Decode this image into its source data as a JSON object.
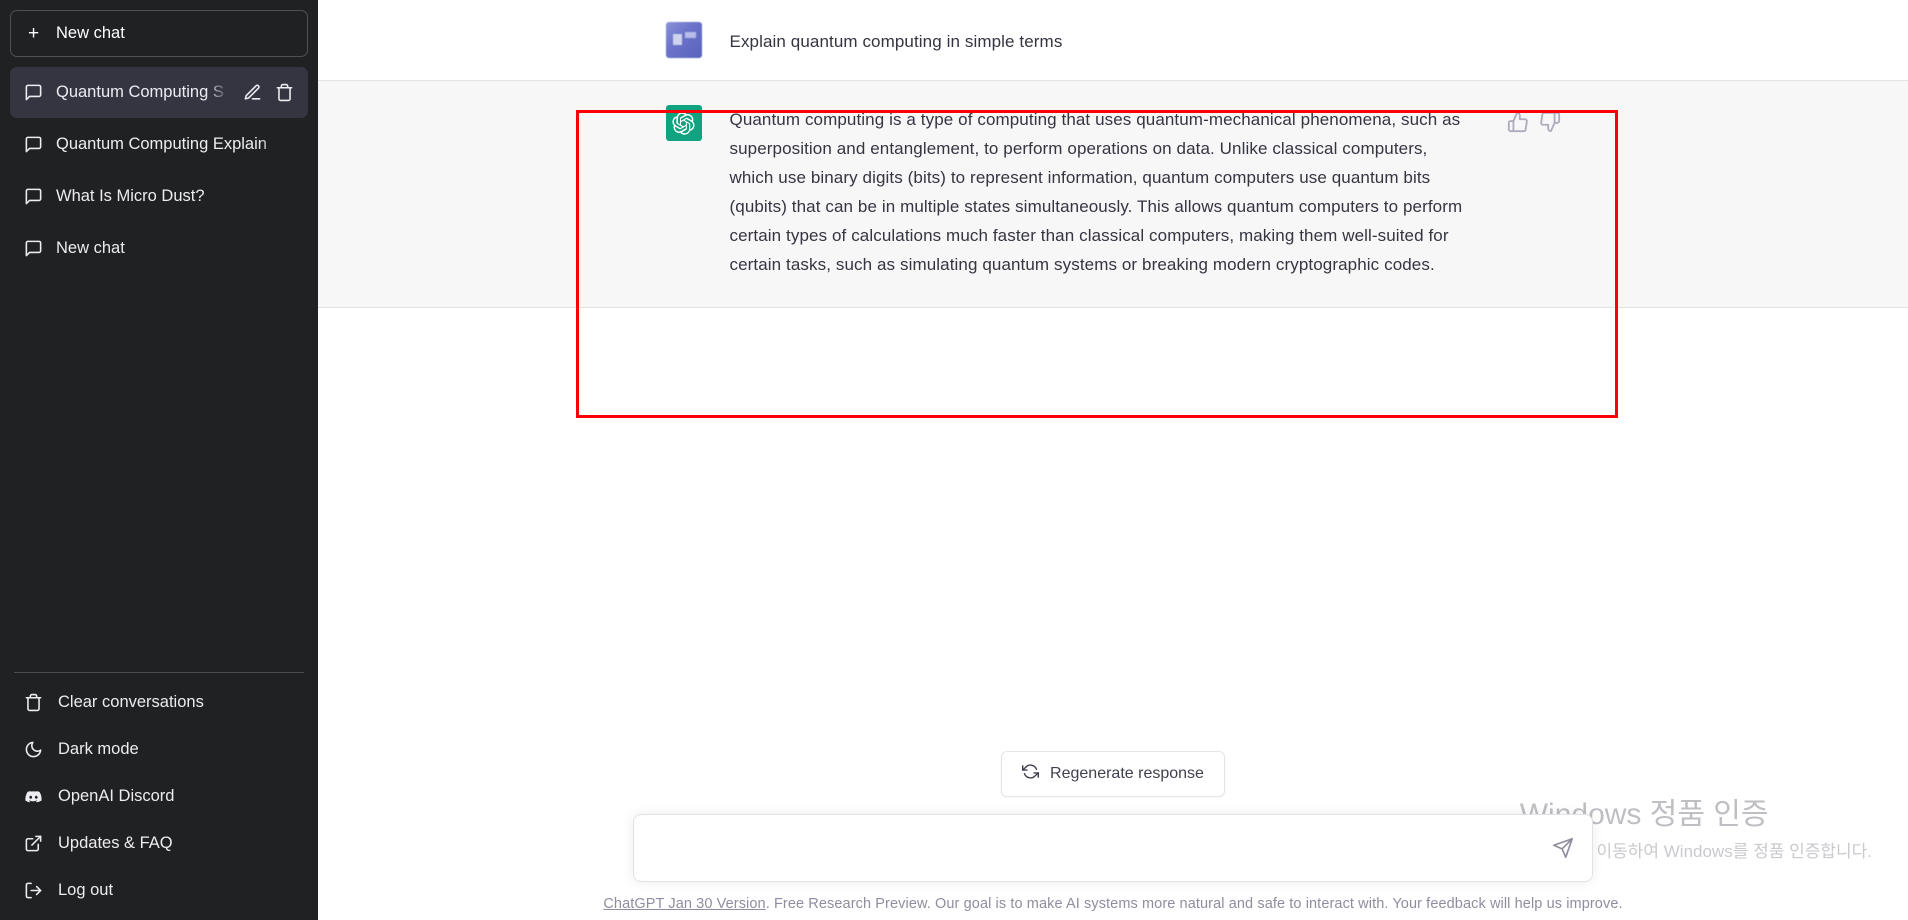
{
  "sidebar": {
    "new_chat_label": "New chat",
    "conversations": [
      {
        "label": "Quantum Computing S",
        "active": true
      },
      {
        "label": "Quantum Computing Explain",
        "active": false
      },
      {
        "label": "What Is Micro Dust?",
        "active": false
      },
      {
        "label": "New chat",
        "active": false
      }
    ],
    "menu": [
      {
        "label": "Clear conversations",
        "icon": "trash-icon"
      },
      {
        "label": "Dark mode",
        "icon": "moon-icon"
      },
      {
        "label": "OpenAI Discord",
        "icon": "discord-icon"
      },
      {
        "label": "Updates & FAQ",
        "icon": "external-link-icon"
      },
      {
        "label": "Log out",
        "icon": "logout-icon"
      }
    ],
    "background_color": "#202123",
    "active_item_color": "#343541"
  },
  "conversation": {
    "user_message": "Explain quantum computing in simple terms",
    "assistant_message": "Quantum computing is a type of computing that uses quantum-mechanical phenomena, such as superposition and entanglement, to perform operations on data. Unlike classical computers, which use binary digits (bits) to represent information, quantum computers use quantum bits (qubits) that can be in multiple states simultaneously. This allows quantum computers to perform certain types of calculations much faster than classical computers, making them well-suited for certain tasks, such as simulating quantum systems or breaking modern cryptographic codes.",
    "assistant_block_color": "#f7f7f8",
    "gpt_avatar_color": "#10a37f"
  },
  "annotation": {
    "color": "#fb0007",
    "note": "red rectangle highlighting the assistant response"
  },
  "actions": {
    "regenerate_label": "Regenerate response",
    "thumbs_up": "thumbs-up-icon",
    "thumbs_down": "thumbs-down-icon"
  },
  "composer": {
    "value": "",
    "placeholder": ""
  },
  "footer": {
    "link_text": "ChatGPT Jan 30 Version",
    "rest_text": ". Free Research Preview. Our goal is to make AI systems more natural and safe to interact with. Your feedback will help us improve."
  },
  "watermark": {
    "title": "Windows 정품 인증",
    "subtitle": "[설정]으로 이동하여 Windows를 정품 인증합니다."
  }
}
